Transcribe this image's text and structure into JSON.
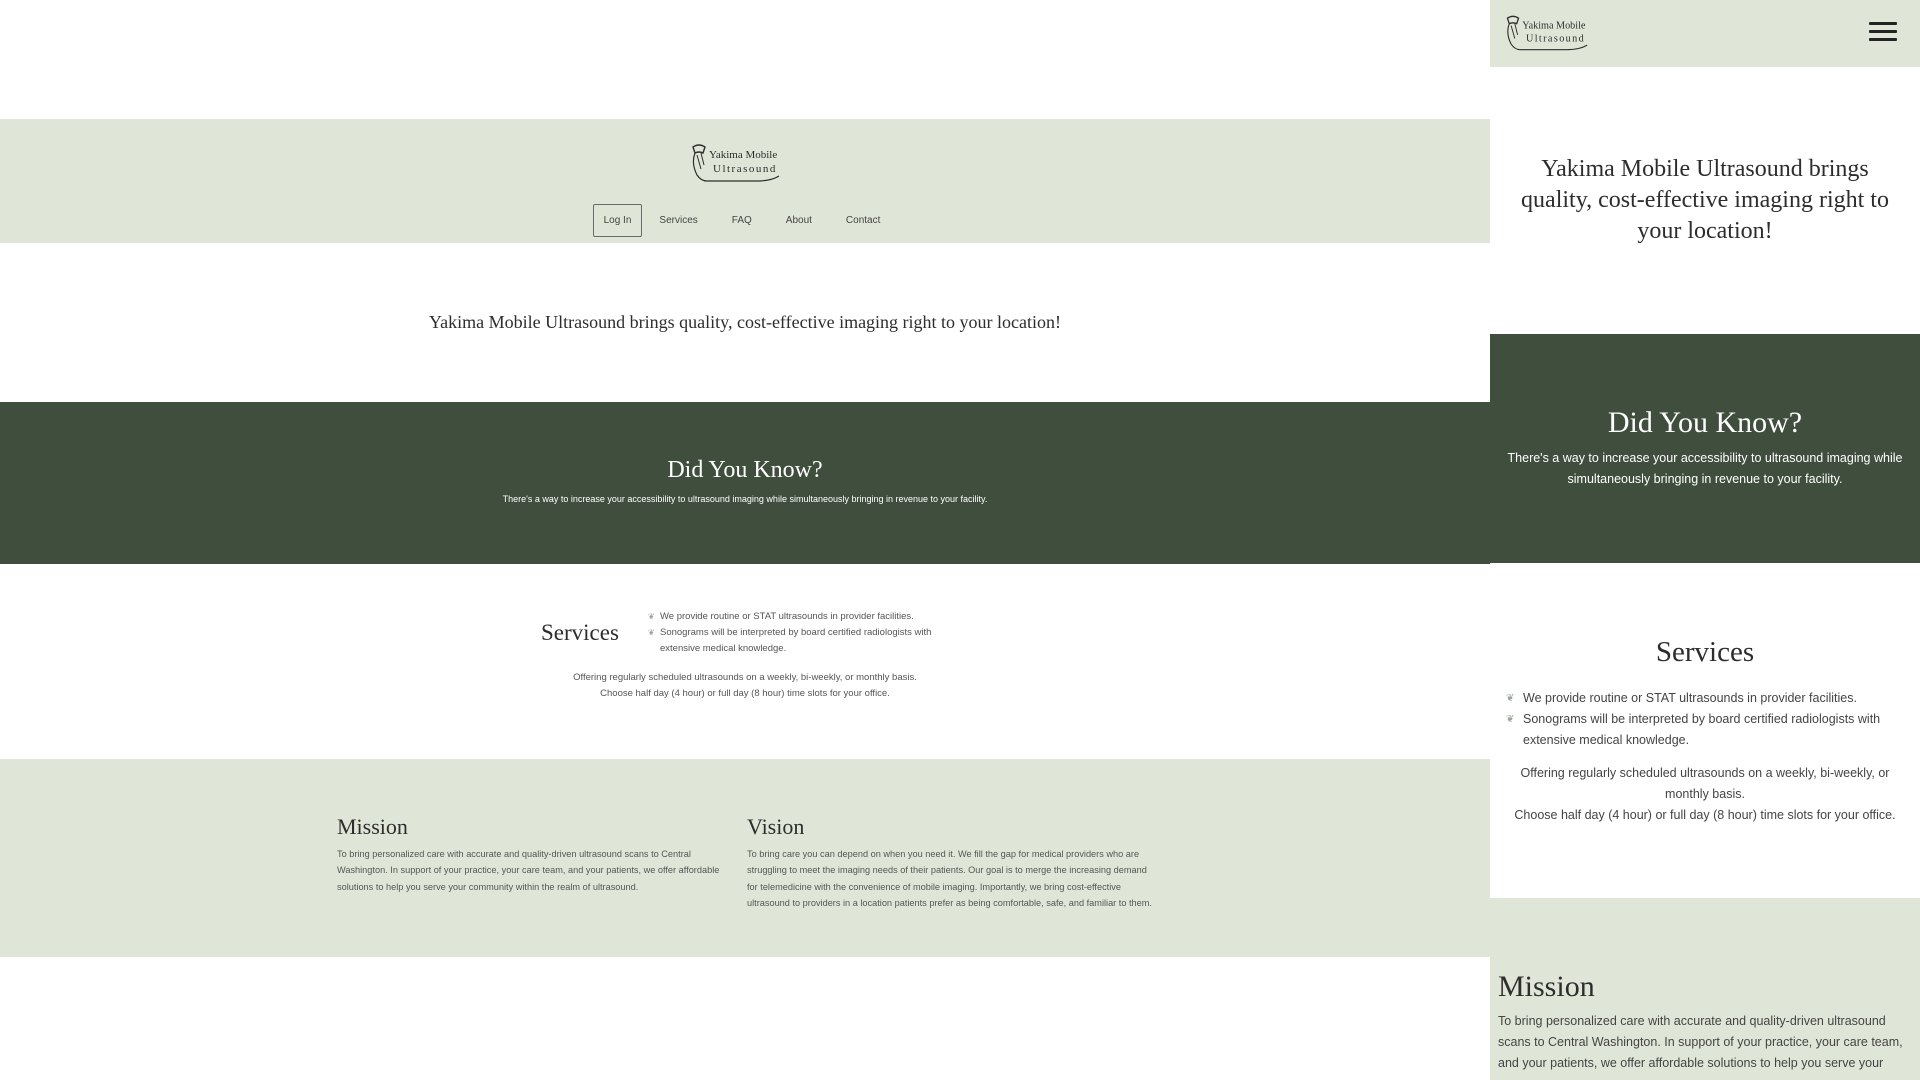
{
  "brand": {
    "name_line1": "Yakima Mobile",
    "name_line2": "Ultrasound"
  },
  "nav": [
    {
      "label": "Log In"
    },
    {
      "label": "Services"
    },
    {
      "label": "FAQ"
    },
    {
      "label": "About"
    },
    {
      "label": "Contact"
    }
  ],
  "hero": {
    "text": "Yakima Mobile Ultrasound brings quality, cost-effective imaging right to your location!"
  },
  "did_you_know": {
    "title": "Did You Know?",
    "text": "There's a way to increase your accessibility to ultrasound imaging while simultaneously bringing in revenue to your facility."
  },
  "services": {
    "title": "Services",
    "items": [
      "We provide routine or STAT ultrasounds in provider facilities.",
      "Sonograms will be interpreted by board certified radiologists with extensive medical knowledge."
    ],
    "offer_line1": "Offering regularly scheduled ultrasounds on a weekly, bi-weekly, or monthly basis.",
    "offer_line2": "Choose half day (4 hour) or full day (8 hour) time slots for your office."
  },
  "mission": {
    "title": "Mission",
    "text": "To bring personalized care with accurate and quality-driven ultrasound scans to Central Washington. In support of your practice, your care team, and your patients, we offer affordable solutions to help you serve your community within the realm of ultrasound."
  },
  "vision": {
    "title": "Vision",
    "text": "To bring care you can depend on when you need it. We fill the gap for medical providers who are struggling to meet the imaging needs of their patients. Our goal is to merge the increasing demand for telemedicine with the convenience of mobile imaging. Importantly, we bring cost-effective ultrasound to providers in a location patients prefer as being comfortable, safe, and familiar to them."
  },
  "mobile_mission_text": "To bring personalized care with accurate and quality-driven ultrasound scans to Central Washington. In support of your practice, your care team, and your patients, we offer affordable solutions to help you serve your",
  "icons": {
    "logo": "ultrasound-probe-logo-icon",
    "bullet": "leaf-icon",
    "menu": "hamburger-menu-icon"
  },
  "colors": {
    "light_band": "#e0e6d7",
    "dark_band": "#404e3e",
    "text_dark": "#2d2d2d"
  }
}
